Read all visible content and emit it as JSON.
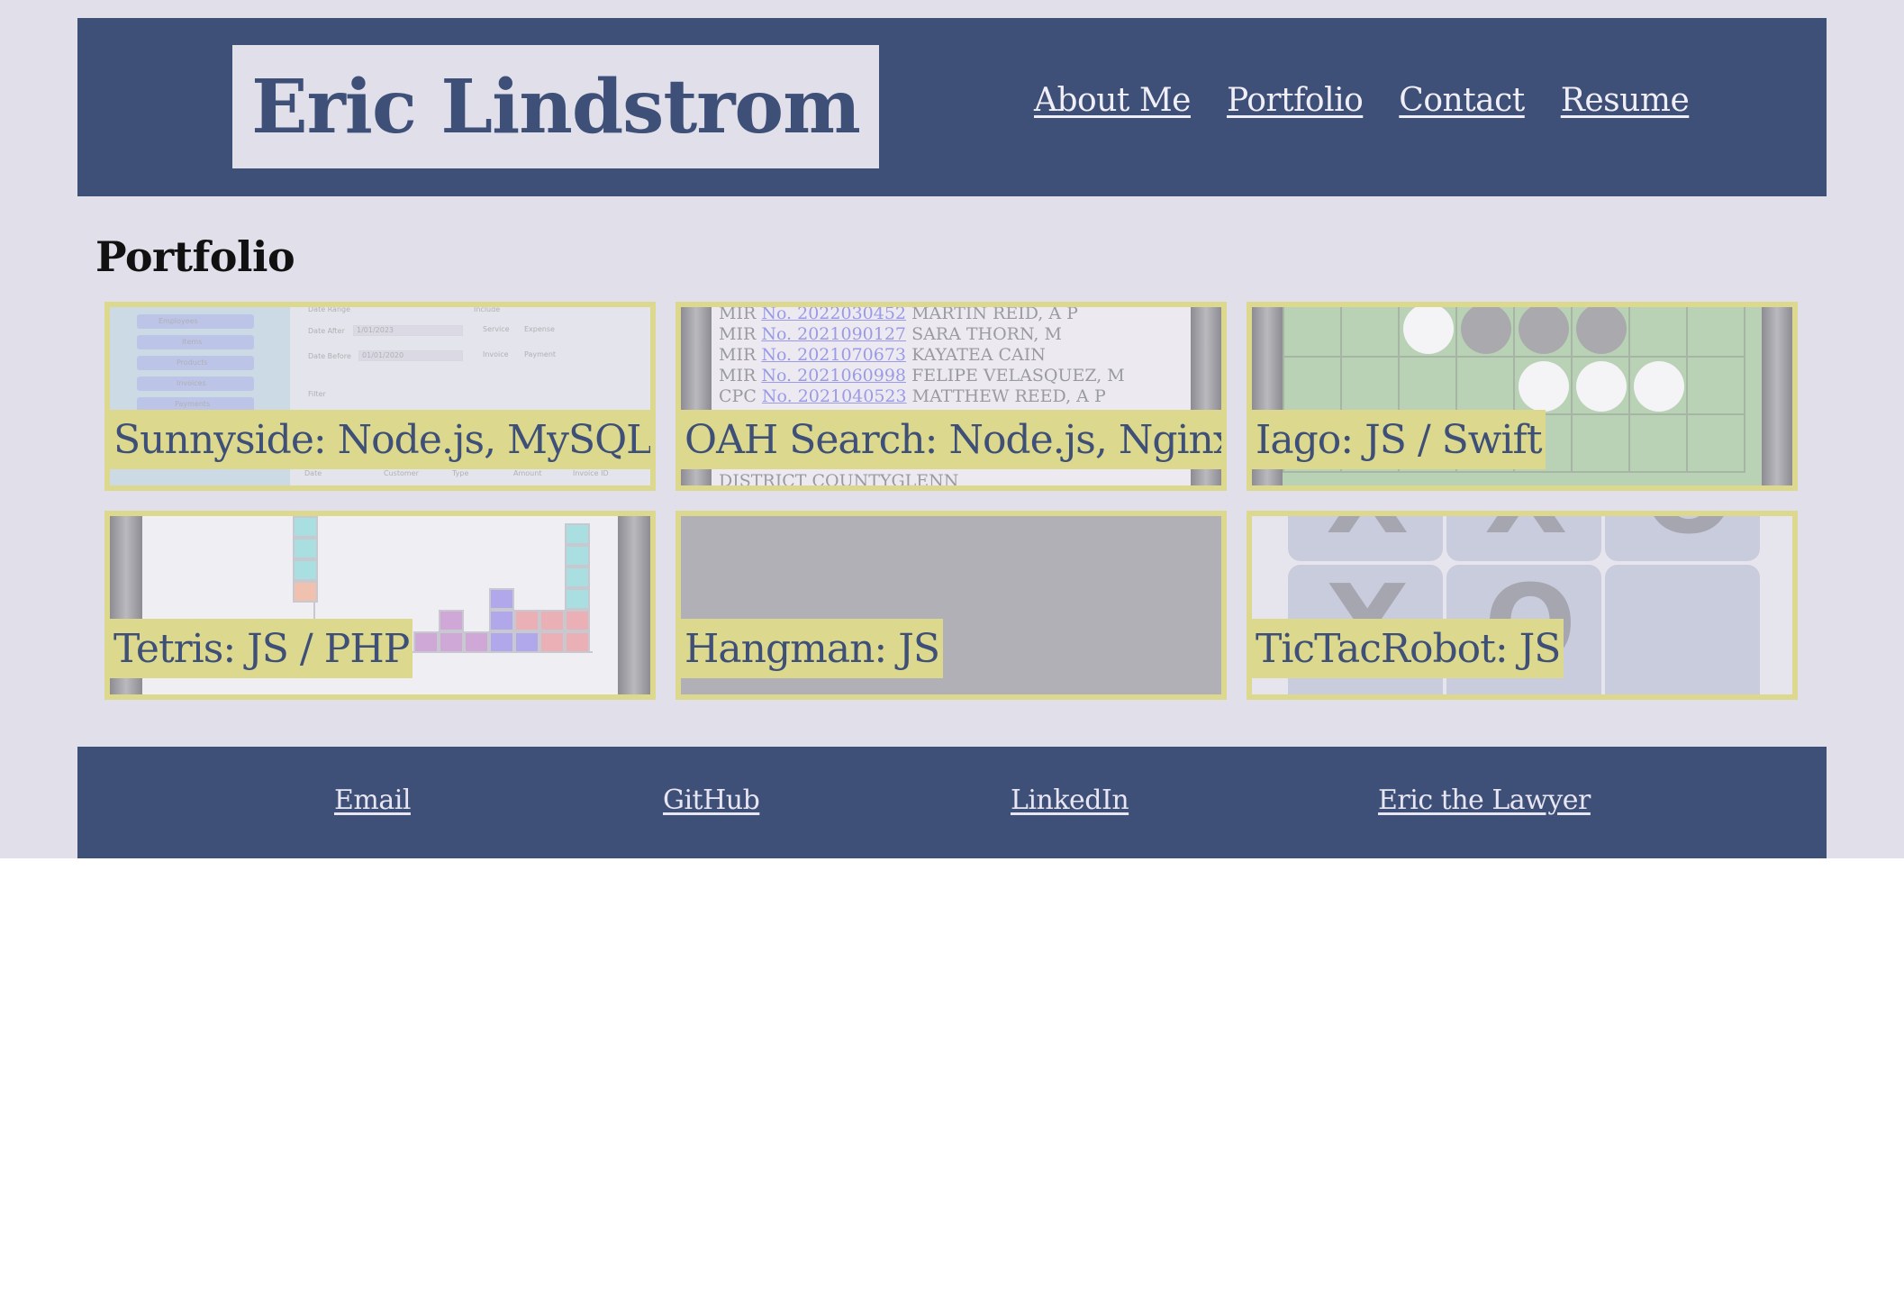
{
  "header": {
    "brand": "Eric Lindstrom",
    "nav": [
      "About Me",
      "Portfolio",
      "Contact",
      "Resume"
    ]
  },
  "portfolio": {
    "title": "Portfolio",
    "projects": [
      {
        "label": "Sunnyside: Node.js, MySQL",
        "thumb": "dashboard-form"
      },
      {
        "label": "OAH Search: Node.js, Nginx",
        "thumb": "search-results"
      },
      {
        "label": "Iago: JS / Swift",
        "thumb": "othello-board"
      },
      {
        "label": "Tetris: JS / PHP",
        "thumb": "tetris-board"
      },
      {
        "label": "Hangman: JS",
        "thumb": "blank-gray"
      },
      {
        "label": "TicTacRobot: JS",
        "thumb": "tictactoe-board"
      }
    ],
    "sunnyside_thumb": {
      "sidebar": [
        "Employees",
        "Items",
        "Products",
        "Invoices",
        "Payments"
      ],
      "fields": [
        "Date Range",
        "Date After",
        "1/01/2023",
        "Date Before",
        "01/01/2020",
        "Include",
        "Service",
        "Expense",
        "Invoice",
        "Payment",
        "Filter"
      ],
      "columns": [
        "Date",
        "Customer",
        "Type",
        "Amount",
        "Invoice ID"
      ]
    },
    "oah_thumb": {
      "rows": [
        {
          "prefix": "MIR",
          "no": "No. 2022030452",
          "name": "MARTIN REID, A P"
        },
        {
          "prefix": "MIR",
          "no": "No. 2021090127",
          "name": "SARA THORN, M"
        },
        {
          "prefix": "MIR",
          "no": "No. 2021070673",
          "name": "KAYATEA CAIN"
        },
        {
          "prefix": "MIR",
          "no": "No. 2021060998",
          "name": "FELIPE VELASQUEZ, M"
        },
        {
          "prefix": "CPC",
          "no": "No. 2021040523",
          "name": "MATTHEW REED, A P"
        }
      ],
      "tail": "DISTRICT COUNTYGLENN"
    },
    "ttt_marks": [
      "X",
      "X",
      "O",
      "X",
      "O"
    ]
  },
  "footer": {
    "links": [
      "Email",
      "GitHub",
      "LinkedIn",
      "Eric the Lawyer"
    ]
  },
  "colors": {
    "header_bg": "#3e4f78",
    "page_bg": "#e1dfe9",
    "card_accent": "#dcd98e"
  }
}
